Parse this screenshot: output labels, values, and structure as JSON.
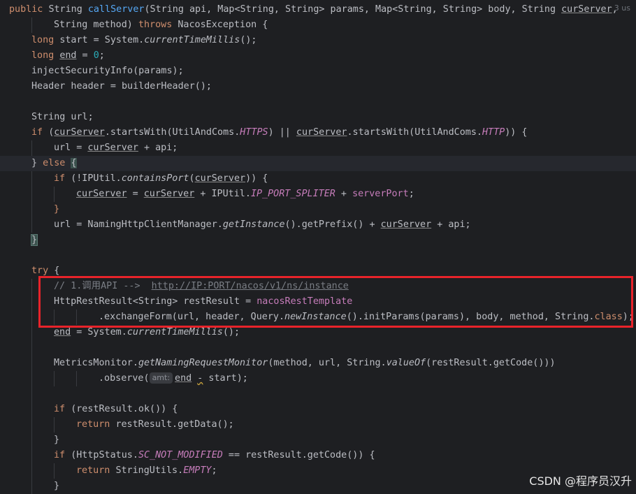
{
  "editor": {
    "usages_hint": "3 us",
    "lines": [
      {
        "indent": 0,
        "caret": false,
        "tokens": [
          {
            "t": "public ",
            "c": "kw"
          },
          {
            "t": "String "
          },
          {
            "t": "callServer",
            "c": "fn"
          },
          {
            "t": "(String api, Map<String, String> params, Map<String, String> body, String "
          },
          {
            "t": "curServer",
            "c": "u"
          },
          {
            "t": ","
          }
        ]
      },
      {
        "indent": 2,
        "caret": false,
        "tokens": [
          {
            "t": "String method) "
          },
          {
            "t": "throws ",
            "c": "kw"
          },
          {
            "t": "NacosException {"
          }
        ]
      },
      {
        "indent": 1,
        "caret": false,
        "tokens": [
          {
            "t": "long ",
            "c": "kw"
          },
          {
            "t": "start = System."
          },
          {
            "t": "currentTimeMillis",
            "c": "it"
          },
          {
            "t": "();"
          }
        ]
      },
      {
        "indent": 1,
        "caret": false,
        "tokens": [
          {
            "t": "long ",
            "c": "kw"
          },
          {
            "t": "end",
            "c": "u"
          },
          {
            "t": " = "
          },
          {
            "t": "0",
            "c": "num"
          },
          {
            "t": ";"
          }
        ]
      },
      {
        "indent": 1,
        "caret": false,
        "tokens": [
          {
            "t": "injectSecurityInfo(params);"
          }
        ]
      },
      {
        "indent": 1,
        "caret": false,
        "tokens": [
          {
            "t": "Header header = builderHeader();"
          }
        ]
      },
      {
        "indent": 1,
        "caret": false,
        "tokens": []
      },
      {
        "indent": 1,
        "caret": false,
        "tokens": [
          {
            "t": "String url;"
          }
        ]
      },
      {
        "indent": 1,
        "caret": false,
        "tokens": [
          {
            "t": "if ",
            "c": "kw"
          },
          {
            "t": "("
          },
          {
            "t": "curServer",
            "c": "u"
          },
          {
            "t": ".startsWith(UtilAndComs."
          },
          {
            "t": "HTTPS",
            "c": "cst"
          },
          {
            "t": ") || "
          },
          {
            "t": "curServer",
            "c": "u"
          },
          {
            "t": ".startsWith(UtilAndComs."
          },
          {
            "t": "HTTP",
            "c": "cst"
          },
          {
            "t": ")) {"
          }
        ]
      },
      {
        "indent": 2,
        "caret": false,
        "tokens": [
          {
            "t": "url = "
          },
          {
            "t": "curServer",
            "c": "u"
          },
          {
            "t": " + api;"
          }
        ]
      },
      {
        "indent": 1,
        "caret": true,
        "tokens": [
          {
            "t": "} "
          },
          {
            "t": "else ",
            "c": "kw"
          },
          {
            "t": "{",
            "c": "bracecur"
          }
        ]
      },
      {
        "indent": 2,
        "caret": false,
        "tokens": [
          {
            "t": "if ",
            "c": "kw"
          },
          {
            "t": "(!IPUtil."
          },
          {
            "t": "containsPort",
            "c": "it"
          },
          {
            "t": "("
          },
          {
            "t": "curServer",
            "c": "u"
          },
          {
            "t": ")) {"
          }
        ]
      },
      {
        "indent": 3,
        "caret": false,
        "tokens": [
          {
            "t": "curServer",
            "c": "u"
          },
          {
            "t": " = "
          },
          {
            "t": "curServer",
            "c": "u"
          },
          {
            "t": " + IPUtil."
          },
          {
            "t": "IP_PORT_SPLITER",
            "c": "cst"
          },
          {
            "t": " + "
          },
          {
            "t": "serverPort",
            "c": "fld"
          },
          {
            "t": ";"
          }
        ]
      },
      {
        "indent": 2,
        "caret": false,
        "tokens": [
          {
            "t": "}",
            "c": "kw"
          }
        ]
      },
      {
        "indent": 2,
        "caret": false,
        "tokens": [
          {
            "t": "url = NamingHttpClientManager."
          },
          {
            "t": "getInstance",
            "c": "it"
          },
          {
            "t": "().getPrefix() + "
          },
          {
            "t": "curServer",
            "c": "u"
          },
          {
            "t": " + api;"
          }
        ]
      },
      {
        "indent": 1,
        "caret": false,
        "tokens": [
          {
            "t": "}",
            "c": "bracehl"
          }
        ]
      },
      {
        "indent": 1,
        "caret": false,
        "tokens": []
      },
      {
        "indent": 1,
        "caret": false,
        "tokens": [
          {
            "t": "try ",
            "c": "kw"
          },
          {
            "t": "{"
          }
        ]
      },
      {
        "indent": 2,
        "caret": false,
        "tokens": [
          {
            "t": "// 1.调用API -->  ",
            "c": "cm"
          },
          {
            "t": "http://IP:PORT/nacos/v1/ns/instance",
            "c": "url"
          }
        ]
      },
      {
        "indent": 2,
        "caret": false,
        "tokens": [
          {
            "t": "HttpRestResult<String> restResult = "
          },
          {
            "t": "nacosRestTemplate",
            "c": "fld"
          }
        ]
      },
      {
        "indent": 4,
        "caret": false,
        "tokens": [
          {
            "t": ".exchangeForm(url, header, Query."
          },
          {
            "t": "newInstance",
            "c": "it"
          },
          {
            "t": "().initParams(params), body, method, String."
          },
          {
            "t": "class",
            "c": "kw"
          },
          {
            "t": ");"
          }
        ]
      },
      {
        "indent": 2,
        "caret": false,
        "tokens": [
          {
            "t": "end",
            "c": "u"
          },
          {
            "t": " = System."
          },
          {
            "t": "currentTimeMillis",
            "c": "it"
          },
          {
            "t": "();"
          }
        ]
      },
      {
        "indent": 2,
        "caret": false,
        "tokens": []
      },
      {
        "indent": 2,
        "caret": false,
        "tokens": [
          {
            "t": "MetricsMonitor."
          },
          {
            "t": "getNamingRequestMonitor",
            "c": "it"
          },
          {
            "t": "(method, url, String."
          },
          {
            "t": "valueOf",
            "c": "it"
          },
          {
            "t": "(restResult.getCode()))"
          }
        ]
      },
      {
        "indent": 4,
        "caret": false,
        "tokens": [
          {
            "t": ".observe("
          },
          {
            "t": "amt:",
            "c": "hint"
          },
          {
            "t": "end",
            "c": "u"
          },
          {
            "t": " "
          },
          {
            "t": "-",
            "c": "wavy"
          },
          {
            "t": " start);"
          }
        ]
      },
      {
        "indent": 2,
        "caret": false,
        "tokens": []
      },
      {
        "indent": 2,
        "caret": false,
        "tokens": [
          {
            "t": "if ",
            "c": "kw"
          },
          {
            "t": "(restResult.ok()) {"
          }
        ]
      },
      {
        "indent": 3,
        "caret": false,
        "tokens": [
          {
            "t": "return ",
            "c": "kw"
          },
          {
            "t": "restResult.getData();"
          }
        ]
      },
      {
        "indent": 2,
        "caret": false,
        "tokens": [
          {
            "t": "}"
          }
        ]
      },
      {
        "indent": 2,
        "caret": false,
        "tokens": [
          {
            "t": "if ",
            "c": "kw"
          },
          {
            "t": "(HttpStatus."
          },
          {
            "t": "SC_NOT_MODIFIED",
            "c": "cst"
          },
          {
            "t": " == restResult.getCode()) {"
          }
        ]
      },
      {
        "indent": 3,
        "caret": false,
        "tokens": [
          {
            "t": "return ",
            "c": "kw"
          },
          {
            "t": "StringUtils."
          },
          {
            "t": "EMPTY",
            "c": "cst"
          },
          {
            "t": ";"
          }
        ]
      },
      {
        "indent": 2,
        "caret": false,
        "tokens": [
          {
            "t": "}"
          }
        ]
      }
    ]
  },
  "watermark": "CSDN @程序员汉升",
  "colors": {
    "background": "#1e1f22",
    "keyword": "#cf8e6d",
    "method": "#56a8f5",
    "constant": "#c77dbb",
    "comment": "#7a7e85",
    "highlight_box": "#e8232a"
  }
}
